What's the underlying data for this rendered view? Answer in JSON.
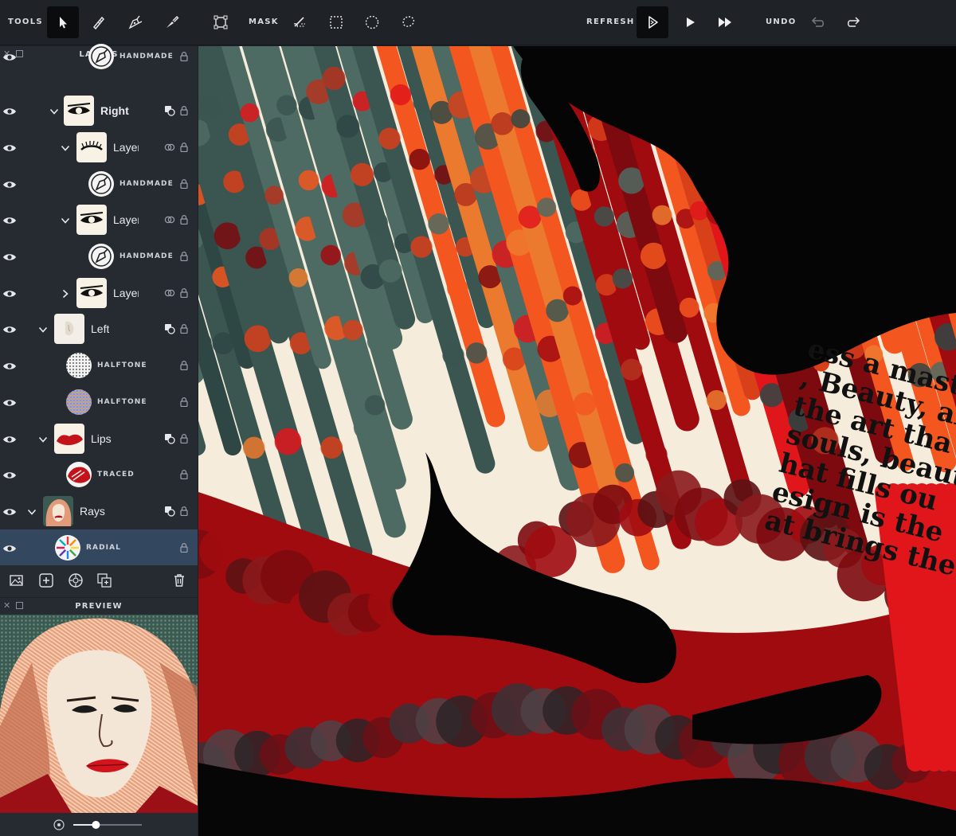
{
  "toolbar": {
    "tools_label": "TOOLS",
    "mask_label": "MASK",
    "refresh_label": "REFRESH",
    "undo_label": "UNDO"
  },
  "layers_panel": {
    "title": "LAYERS",
    "rows": [
      {
        "name": "HANDMADE",
        "thumb": "handmade-icon"
      },
      {
        "name": "Right",
        "thumb": "eye-drawing"
      },
      {
        "name": "Layer",
        "thumb": "eyelash-drawing"
      },
      {
        "name": "HANDMADE",
        "thumb": "handmade-icon"
      },
      {
        "name": "Layer",
        "thumb": "eye-drawing"
      },
      {
        "name": "HANDMADE",
        "thumb": "handmade-icon"
      },
      {
        "name": "Layer",
        "thumb": "eye-drawing"
      },
      {
        "name": "Left",
        "thumb": "face-drawing"
      },
      {
        "name": "HALFTONE",
        "thumb": "halftone-gray"
      },
      {
        "name": "HALFTONE",
        "thumb": "halftone-color"
      },
      {
        "name": "Lips",
        "thumb": "lips-drawing"
      },
      {
        "name": "TRACED",
        "thumb": "traced-icon"
      },
      {
        "name": "Rays",
        "thumb": "portrait"
      },
      {
        "name": "RADIAL",
        "thumb": "radial-icon"
      }
    ]
  },
  "preview_panel": {
    "title": "PREVIEW",
    "zoom_level": 0.33
  },
  "canvas": {
    "quote_lines": [
      "ess a mast",
      ", Beauty, an",
      "the art tha",
      "souls, beaut",
      "hat fills ou",
      "esign is the",
      "at brings the"
    ]
  },
  "colors": {
    "toolbar_bg": "#1f2227",
    "panel_bg": "#262a31",
    "selected_row": "#33475e",
    "canvas_cream": "#f5ecdc",
    "accent_red": "#e0161b",
    "dark_red": "#a00b10",
    "teal": "#3b5550",
    "orange": "#f3561f"
  }
}
